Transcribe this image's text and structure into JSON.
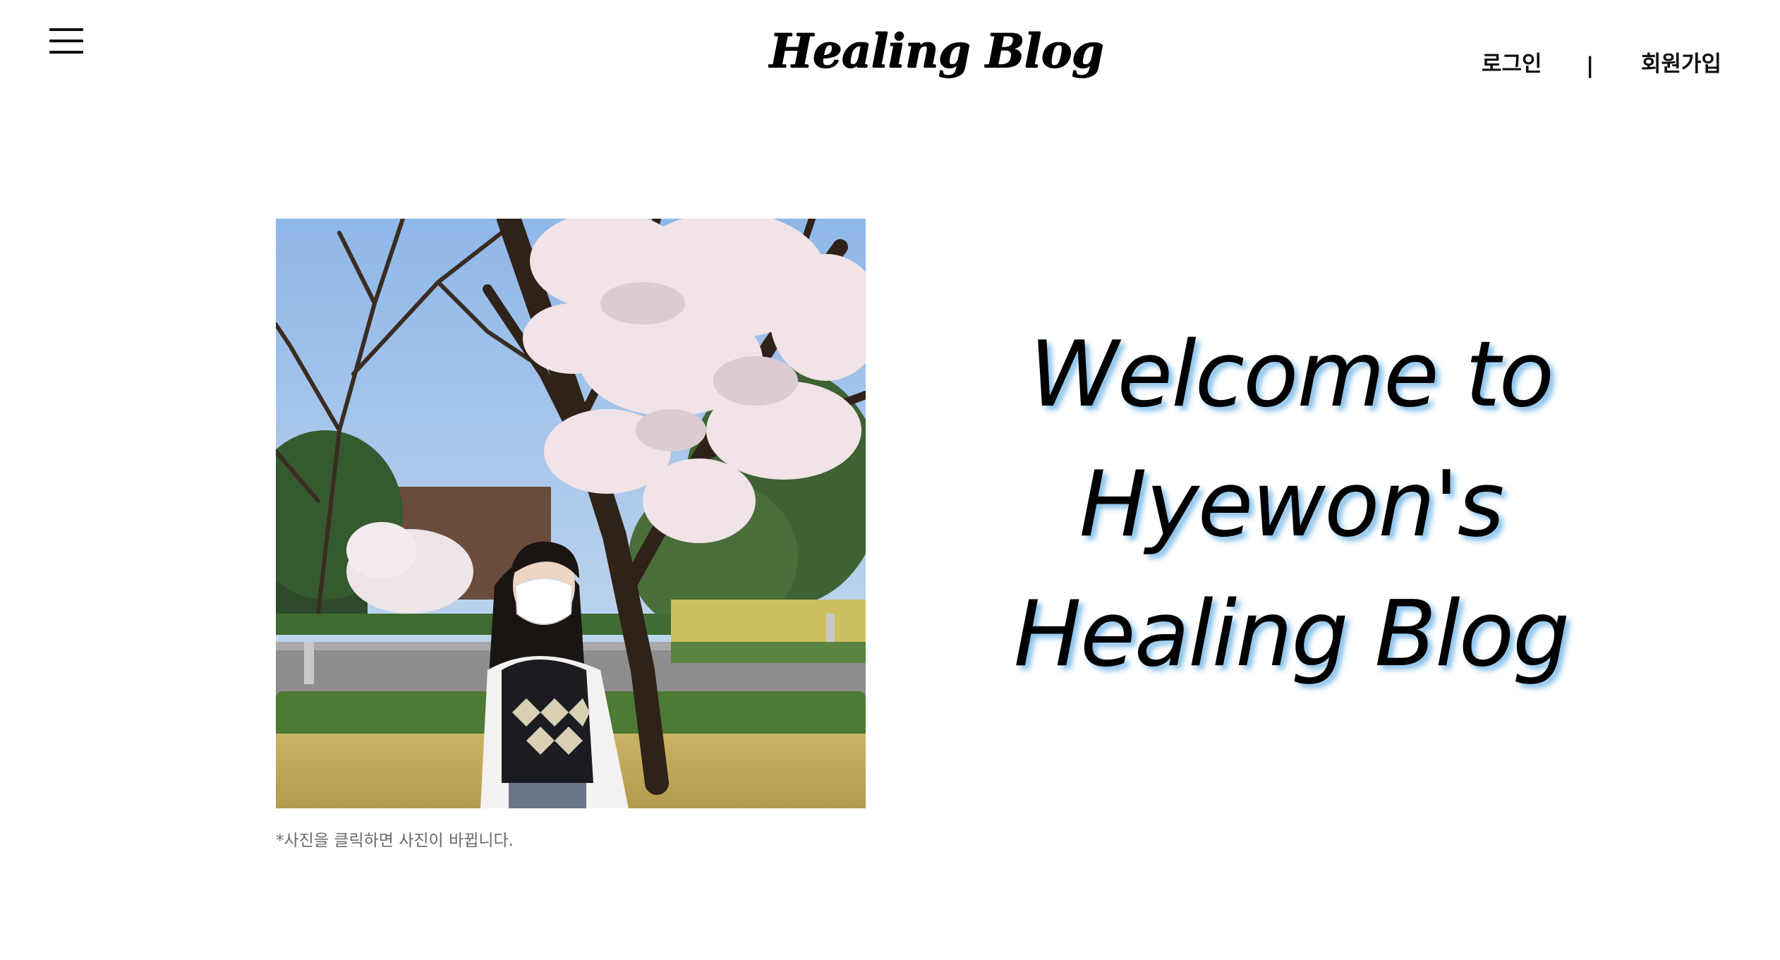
{
  "header": {
    "logo": "Healing Blog",
    "menu_icon": "hamburger-menu-icon",
    "login_label": "로그인",
    "separator": "|",
    "signup_label": "회원가입"
  },
  "hero": {
    "photo_alt": "",
    "caption": "*사진을 클릭하면 사진이 바뀝니다.",
    "welcome_lines": [
      "Welcome to",
      "Hyewon's",
      "Healing Blog"
    ]
  },
  "colors": {
    "text": "#000000",
    "caption": "#6a6a6a",
    "headline_shadow": "#6eb4e6"
  }
}
